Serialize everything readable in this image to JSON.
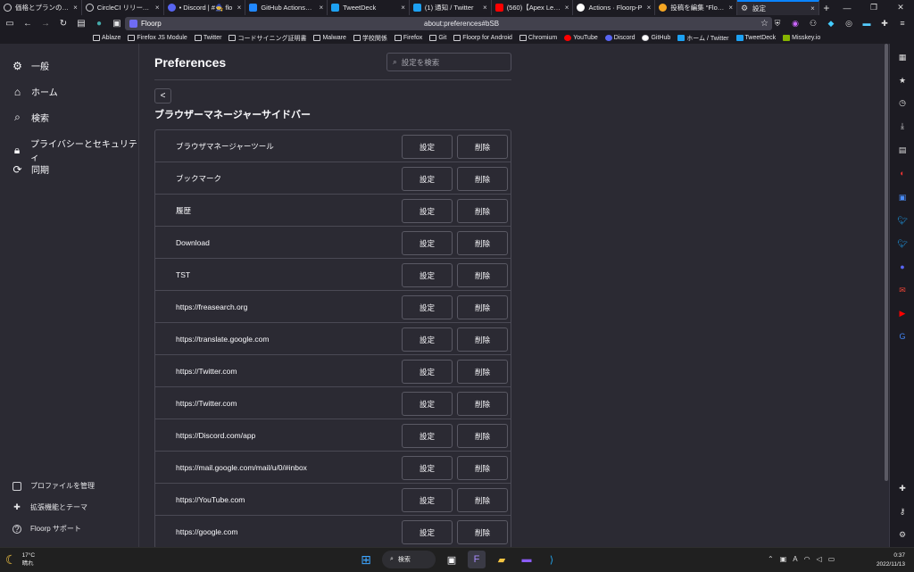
{
  "tabs": [
    {
      "title": "価格とプランの情報 -",
      "color": "#cfcfd4"
    },
    {
      "title": "CircleCI リリース ジ",
      "color": "#cfcfd4"
    },
    {
      "title": "• Discord | #🧙 flo",
      "color": "#5865f2"
    },
    {
      "title": "GitHub Actionsにつ",
      "color": "#2188ff"
    },
    {
      "title": "TweetDeck",
      "color": "#1da1f2"
    },
    {
      "title": "(1) 通知 / Twitter",
      "color": "#1da1f2"
    },
    {
      "title": "(560)【Apex Legen",
      "color": "#ff0000"
    },
    {
      "title": "Actions · Floorp-P",
      "color": "#ffffff"
    },
    {
      "title": "投稿を編集 “Floorp",
      "color": "#f5a623"
    },
    {
      "title": "設定",
      "color": "#cfcfd4"
    }
  ],
  "url": {
    "identity": "Floorp",
    "address": "about:preferences#bSB"
  },
  "bookmarks": [
    "Ablaze",
    "Firefox JS Module",
    "Twitter",
    "コードサイニング証明書",
    "Malware",
    "学校関係",
    "Firefox",
    "Git",
    "Floorp for Android",
    "Chromium",
    "YouTube",
    "Discord",
    "GitHub",
    "ホーム / Twitter",
    "TweetDeck",
    "Misskey.io"
  ],
  "nav": {
    "categories": [
      {
        "label": "一般",
        "icon": "gear"
      },
      {
        "label": "ホーム",
        "icon": "home"
      },
      {
        "label": "検索",
        "icon": "search"
      },
      {
        "label": "プライバシーとセキュリティ",
        "icon": "lock"
      },
      {
        "label": "同期",
        "icon": "sync"
      }
    ],
    "footer": [
      {
        "label": "プロファイルを管理"
      },
      {
        "label": "拡張機能とテーマ"
      },
      {
        "label": "Floorp サポート"
      }
    ]
  },
  "page": {
    "title": "Preferences",
    "search_placeholder": "設定を検索",
    "back": "<",
    "section": "ブラウザーマネージャーサイドバー",
    "set_label": "設定",
    "delete_label": "削除",
    "rows": [
      "ブラウザマネージャーツール",
      "ブックマーク",
      "履歴",
      "Download",
      "TST",
      "https://freasearch.org",
      "https://translate.google.com",
      "https://Twitter.com",
      "https://Twitter.com",
      "https://Discord.com/app",
      "https://mail.google.com/mail/u/0/#inbox",
      "https://YouTube.com",
      "https://google.com"
    ]
  },
  "taskbar": {
    "temp": "17°C",
    "weather": "晴れ",
    "search": "検索",
    "time": "0:37",
    "date": "2022/11/13",
    "lang": "A"
  },
  "colors": {
    "bg": "#2b2a33",
    "chrome": "#1c1b22",
    "accent": "#0a84ff",
    "taskbar": "#202020"
  }
}
